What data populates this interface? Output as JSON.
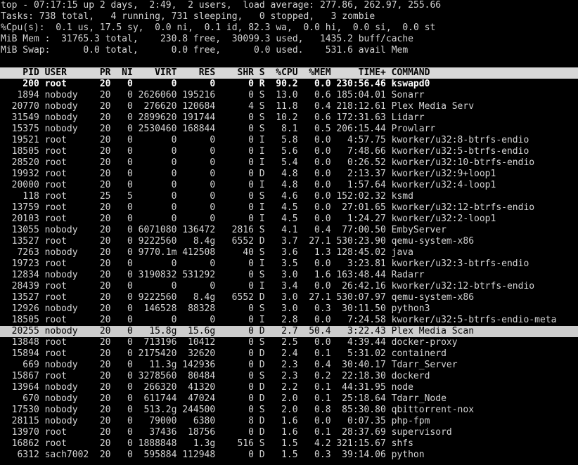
{
  "summary": {
    "line1": "top - 07:17:15 up 2 days,  2:49,  2 users,  load average: 277.86, 262.97, 255.66",
    "line2": "Tasks: 738 total,   4 running, 731 sleeping,   0 stopped,   3 zombie",
    "line3": "%Cpu(s):  0.1 us, 17.5 sy,  0.0 ni,  0.1 id, 82.3 wa,  0.0 hi,  0.0 si,  0.0 st",
    "line4": "MiB Mem :  31765.3 total,    230.8 free,  30099.3 used,   1435.2 buff/cache",
    "line5": "MiB Swap:      0.0 total,      0.0 free,      0.0 used.    531.6 avail Mem"
  },
  "columns": {
    "pid": "PID",
    "user": "USER",
    "pr": "PR",
    "ni": "NI",
    "virt": "VIRT",
    "res": "RES",
    "shr": "SHR",
    "s": "S",
    "cpu": "%CPU",
    "mem": "%MEM",
    "time": "TIME+",
    "command": "COMMAND"
  },
  "processes": [
    {
      "pid": "200",
      "user": "root",
      "pr": "20",
      "ni": "0",
      "virt": "0",
      "res": "0",
      "shr": "0",
      "s": "R",
      "cpu": "90.2",
      "mem": "0.0",
      "time": "230:56.46",
      "command": "kswapd0",
      "bold": true,
      "selected": false
    },
    {
      "pid": "1894",
      "user": "nobody",
      "pr": "20",
      "ni": "0",
      "virt": "2626060",
      "res": "195216",
      "shr": "0",
      "s": "S",
      "cpu": "13.0",
      "mem": "0.6",
      "time": "185:04.01",
      "command": "Sonarr",
      "bold": false,
      "selected": false
    },
    {
      "pid": "20770",
      "user": "nobody",
      "pr": "20",
      "ni": "0",
      "virt": "276620",
      "res": "120684",
      "shr": "4",
      "s": "S",
      "cpu": "11.8",
      "mem": "0.4",
      "time": "218:12.61",
      "command": "Plex Media Serv",
      "bold": false,
      "selected": false
    },
    {
      "pid": "31549",
      "user": "nobody",
      "pr": "20",
      "ni": "0",
      "virt": "2899620",
      "res": "191744",
      "shr": "0",
      "s": "S",
      "cpu": "10.2",
      "mem": "0.6",
      "time": "172:31.63",
      "command": "Lidarr",
      "bold": false,
      "selected": false
    },
    {
      "pid": "15375",
      "user": "nobody",
      "pr": "20",
      "ni": "0",
      "virt": "2530460",
      "res": "168844",
      "shr": "0",
      "s": "S",
      "cpu": "8.1",
      "mem": "0.5",
      "time": "206:15.44",
      "command": "Prowlarr",
      "bold": false,
      "selected": false
    },
    {
      "pid": "19521",
      "user": "root",
      "pr": "20",
      "ni": "0",
      "virt": "0",
      "res": "0",
      "shr": "0",
      "s": "I",
      "cpu": "5.8",
      "mem": "0.0",
      "time": "4:57.75",
      "command": "kworker/u32:8-btrfs-endio",
      "bold": false,
      "selected": false
    },
    {
      "pid": "18505",
      "user": "root",
      "pr": "20",
      "ni": "0",
      "virt": "0",
      "res": "0",
      "shr": "0",
      "s": "I",
      "cpu": "5.6",
      "mem": "0.0",
      "time": "7:48.66",
      "command": "kworker/u32:5-btrfs-endio",
      "bold": false,
      "selected": false
    },
    {
      "pid": "28520",
      "user": "root",
      "pr": "20",
      "ni": "0",
      "virt": "0",
      "res": "0",
      "shr": "0",
      "s": "I",
      "cpu": "5.4",
      "mem": "0.0",
      "time": "0:26.52",
      "command": "kworker/u32:10-btrfs-endio",
      "bold": false,
      "selected": false
    },
    {
      "pid": "19932",
      "user": "root",
      "pr": "20",
      "ni": "0",
      "virt": "0",
      "res": "0",
      "shr": "0",
      "s": "D",
      "cpu": "4.8",
      "mem": "0.0",
      "time": "2:13.37",
      "command": "kworker/u32:9+loop1",
      "bold": false,
      "selected": false
    },
    {
      "pid": "20000",
      "user": "root",
      "pr": "20",
      "ni": "0",
      "virt": "0",
      "res": "0",
      "shr": "0",
      "s": "I",
      "cpu": "4.8",
      "mem": "0.0",
      "time": "1:57.64",
      "command": "kworker/u32:4-loop1",
      "bold": false,
      "selected": false
    },
    {
      "pid": "118",
      "user": "root",
      "pr": "25",
      "ni": "5",
      "virt": "0",
      "res": "0",
      "shr": "0",
      "s": "S",
      "cpu": "4.6",
      "mem": "0.0",
      "time": "152:02.32",
      "command": "ksmd",
      "bold": false,
      "selected": false
    },
    {
      "pid": "13759",
      "user": "root",
      "pr": "20",
      "ni": "0",
      "virt": "0",
      "res": "0",
      "shr": "0",
      "s": "I",
      "cpu": "4.5",
      "mem": "0.0",
      "time": "27:01.65",
      "command": "kworker/u32:12-btrfs-endio",
      "bold": false,
      "selected": false
    },
    {
      "pid": "20103",
      "user": "root",
      "pr": "20",
      "ni": "0",
      "virt": "0",
      "res": "0",
      "shr": "0",
      "s": "I",
      "cpu": "4.5",
      "mem": "0.0",
      "time": "1:24.27",
      "command": "kworker/u32:2-loop1",
      "bold": false,
      "selected": false
    },
    {
      "pid": "13055",
      "user": "nobody",
      "pr": "20",
      "ni": "0",
      "virt": "6071080",
      "res": "136472",
      "shr": "2816",
      "s": "S",
      "cpu": "4.1",
      "mem": "0.4",
      "time": "77:00.50",
      "command": "EmbyServer",
      "bold": false,
      "selected": false
    },
    {
      "pid": "13527",
      "user": "root",
      "pr": "20",
      "ni": "0",
      "virt": "9222560",
      "res": "8.4g",
      "shr": "6552",
      "s": "D",
      "cpu": "3.7",
      "mem": "27.1",
      "time": "530:23.90",
      "command": "qemu-system-x86",
      "bold": false,
      "selected": false
    },
    {
      "pid": "7263",
      "user": "nobody",
      "pr": "20",
      "ni": "0",
      "virt": "9770.1m",
      "res": "412508",
      "shr": "40",
      "s": "S",
      "cpu": "3.6",
      "mem": "1.3",
      "time": "128:45.02",
      "command": "java",
      "bold": false,
      "selected": false
    },
    {
      "pid": "19723",
      "user": "root",
      "pr": "20",
      "ni": "0",
      "virt": "0",
      "res": "0",
      "shr": "0",
      "s": "I",
      "cpu": "3.5",
      "mem": "0.0",
      "time": "3:23.81",
      "command": "kworker/u32:3-btrfs-endio",
      "bold": false,
      "selected": false
    },
    {
      "pid": "12834",
      "user": "nobody",
      "pr": "20",
      "ni": "0",
      "virt": "3190832",
      "res": "531292",
      "shr": "0",
      "s": "S",
      "cpu": "3.0",
      "mem": "1.6",
      "time": "163:48.44",
      "command": "Radarr",
      "bold": false,
      "selected": false
    },
    {
      "pid": "28439",
      "user": "root",
      "pr": "20",
      "ni": "0",
      "virt": "0",
      "res": "0",
      "shr": "0",
      "s": "I",
      "cpu": "3.4",
      "mem": "0.0",
      "time": "26:42.16",
      "command": "kworker/u32:12-btrfs-endio",
      "bold": false,
      "selected": false
    },
    {
      "pid": "13527",
      "user": "root",
      "pr": "20",
      "ni": "0",
      "virt": "9222560",
      "res": "8.4g",
      "shr": "6552",
      "s": "D",
      "cpu": "3.0",
      "mem": "27.1",
      "time": "530:07.97",
      "command": "qemu-system-x86",
      "bold": false,
      "selected": false
    },
    {
      "pid": "12926",
      "user": "nobody",
      "pr": "20",
      "ni": "0",
      "virt": "146528",
      "res": "88328",
      "shr": "0",
      "s": "S",
      "cpu": "3.0",
      "mem": "0.3",
      "time": "30:11.50",
      "command": "python3",
      "bold": false,
      "selected": false
    },
    {
      "pid": "18505",
      "user": "root",
      "pr": "20",
      "ni": "0",
      "virt": "0",
      "res": "0",
      "shr": "0",
      "s": "I",
      "cpu": "2.8",
      "mem": "0.0",
      "time": "7:24.58",
      "command": "kworker/u32:5-btrfs-endio-meta",
      "bold": false,
      "selected": false
    },
    {
      "pid": "20255",
      "user": "nobody",
      "pr": "20",
      "ni": "0",
      "virt": "15.8g",
      "res": "15.6g",
      "shr": "0",
      "s": "D",
      "cpu": "2.7",
      "mem": "50.4",
      "time": "3:22.43",
      "command": "Plex Media Scan",
      "bold": false,
      "selected": true
    },
    {
      "pid": "13848",
      "user": "root",
      "pr": "20",
      "ni": "0",
      "virt": "713196",
      "res": "10412",
      "shr": "0",
      "s": "S",
      "cpu": "2.5",
      "mem": "0.0",
      "time": "4:39.44",
      "command": "docker-proxy",
      "bold": false,
      "selected": false
    },
    {
      "pid": "15894",
      "user": "root",
      "pr": "20",
      "ni": "0",
      "virt": "2175420",
      "res": "32620",
      "shr": "0",
      "s": "D",
      "cpu": "2.4",
      "mem": "0.1",
      "time": "5:31.02",
      "command": "containerd",
      "bold": false,
      "selected": false
    },
    {
      "pid": "669",
      "user": "nobody",
      "pr": "20",
      "ni": "0",
      "virt": "11.3g",
      "res": "142936",
      "shr": "0",
      "s": "D",
      "cpu": "2.3",
      "mem": "0.4",
      "time": "30:40.17",
      "command": "Tdarr_Server",
      "bold": false,
      "selected": false
    },
    {
      "pid": "15867",
      "user": "root",
      "pr": "20",
      "ni": "0",
      "virt": "3278560",
      "res": "80484",
      "shr": "0",
      "s": "S",
      "cpu": "2.3",
      "mem": "0.2",
      "time": "22:18.30",
      "command": "dockerd",
      "bold": false,
      "selected": false
    },
    {
      "pid": "13964",
      "user": "nobody",
      "pr": "20",
      "ni": "0",
      "virt": "266320",
      "res": "41320",
      "shr": "0",
      "s": "D",
      "cpu": "2.2",
      "mem": "0.1",
      "time": "44:31.95",
      "command": "node",
      "bold": false,
      "selected": false
    },
    {
      "pid": "670",
      "user": "nobody",
      "pr": "20",
      "ni": "0",
      "virt": "611744",
      "res": "47024",
      "shr": "0",
      "s": "D",
      "cpu": "2.0",
      "mem": "0.1",
      "time": "25:18.64",
      "command": "Tdarr_Node",
      "bold": false,
      "selected": false
    },
    {
      "pid": "17530",
      "user": "nobody",
      "pr": "20",
      "ni": "0",
      "virt": "513.2g",
      "res": "244500",
      "shr": "0",
      "s": "S",
      "cpu": "2.0",
      "mem": "0.8",
      "time": "85:30.80",
      "command": "qbittorrent-nox",
      "bold": false,
      "selected": false
    },
    {
      "pid": "28115",
      "user": "nobody",
      "pr": "20",
      "ni": "0",
      "virt": "79000",
      "res": "6380",
      "shr": "8",
      "s": "D",
      "cpu": "1.6",
      "mem": "0.0",
      "time": "0:07.35",
      "command": "php-fpm",
      "bold": false,
      "selected": false
    },
    {
      "pid": "13970",
      "user": "root",
      "pr": "20",
      "ni": "0",
      "virt": "37436",
      "res": "18756",
      "shr": "0",
      "s": "D",
      "cpu": "1.6",
      "mem": "0.1",
      "time": "28:37.69",
      "command": "supervisord",
      "bold": false,
      "selected": false
    },
    {
      "pid": "16862",
      "user": "root",
      "pr": "20",
      "ni": "0",
      "virt": "1888848",
      "res": "1.3g",
      "shr": "516",
      "s": "S",
      "cpu": "1.5",
      "mem": "4.2",
      "time": "321:15.67",
      "command": "shfs",
      "bold": false,
      "selected": false
    },
    {
      "pid": "6312",
      "user": "sach7002",
      "pr": "20",
      "ni": "0",
      "virt": "595884",
      "res": "112948",
      "shr": "0",
      "s": "D",
      "cpu": "1.5",
      "mem": "0.3",
      "time": "39:14.06",
      "command": "python",
      "bold": false,
      "selected": false
    }
  ]
}
